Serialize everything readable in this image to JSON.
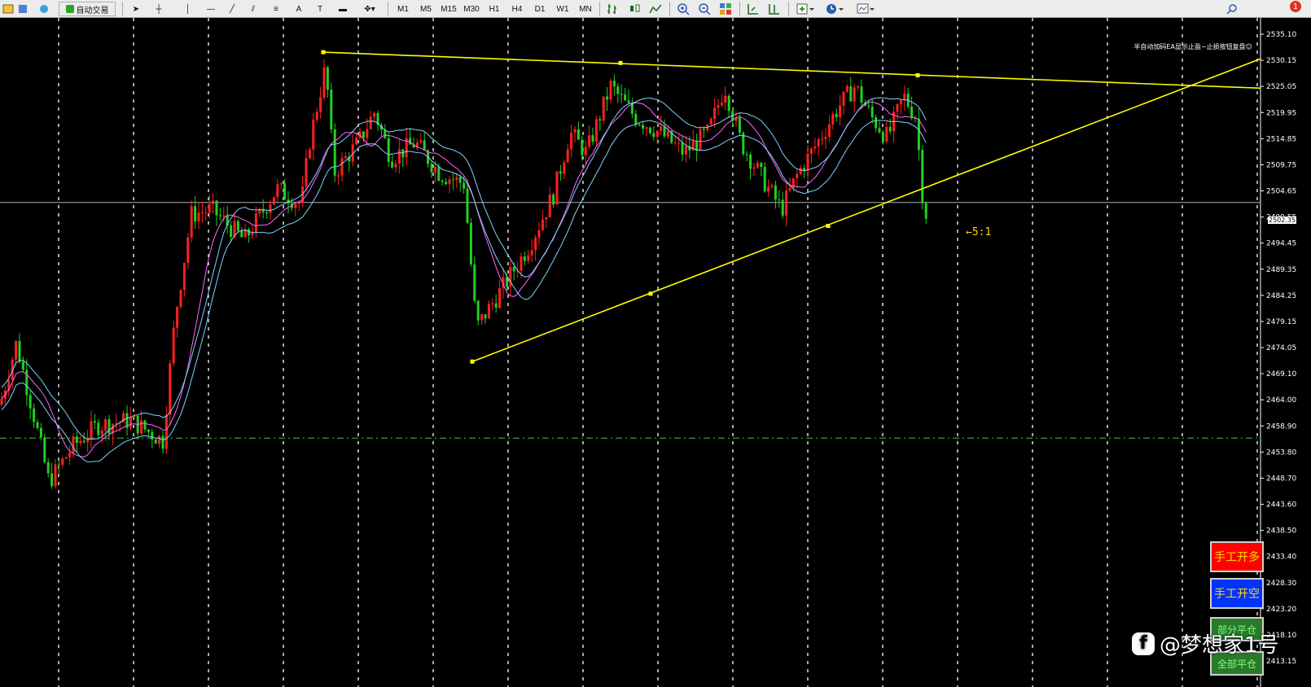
{
  "toolbar": {
    "auto_trading_label": "自动交易",
    "timeframes": [
      "M1",
      "M5",
      "M15",
      "M30",
      "H1",
      "H4",
      "D1",
      "W1",
      "MN"
    ],
    "notification_count": "1"
  },
  "chart": {
    "ea_label": "半自动加码EA显示止盈~止损按钮复盘☺",
    "current_price": "2502.35",
    "ratio_label": "←5:1",
    "price_axis": [
      "2535.10",
      "2530.15",
      "2525.05",
      "2519.95",
      "2514.85",
      "2509.75",
      "2504.65",
      "2499.55",
      "2494.45",
      "2489.35",
      "2484.25",
      "2479.15",
      "2474.05",
      "2469.10",
      "2464.00",
      "2458.90",
      "2453.80",
      "2448.70",
      "2443.60",
      "2438.50",
      "2433.40",
      "2428.30",
      "2423.20",
      "2418.10",
      "2413.15"
    ],
    "colors": {
      "bull": "#ff2020",
      "bear": "#20d020",
      "trendline": "#ffff00",
      "ma_fast": "#ff66ff",
      "ma_slow": "#7fd3ff",
      "grid": "#ffffff",
      "level": "#3a9a3a"
    }
  },
  "buttons": {
    "manual_long": "手工开多",
    "manual_short": "手工开空",
    "half_close": "部分平仓",
    "close_all": "全部平仓"
  },
  "watermark": {
    "icon": "toutiao-icon",
    "text": "@梦想家1号"
  }
}
